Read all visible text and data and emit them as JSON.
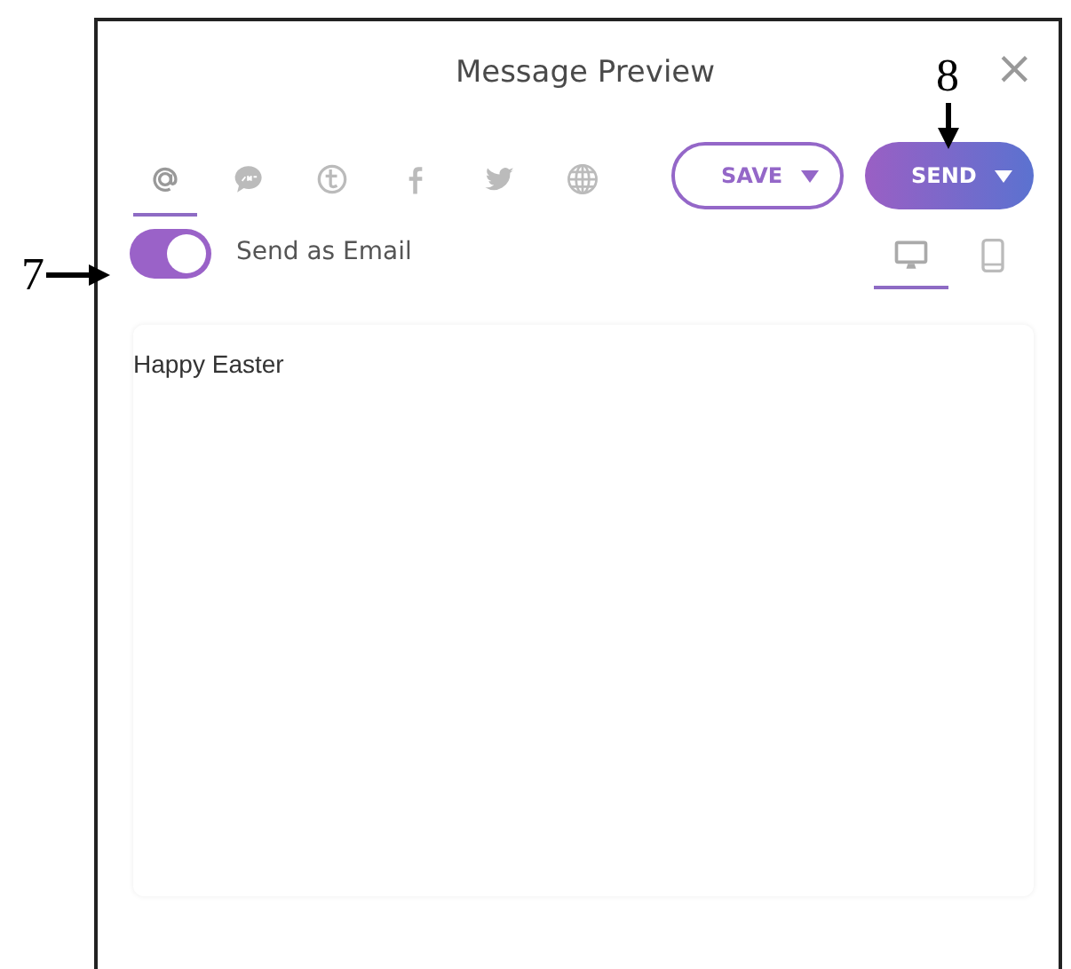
{
  "dialog": {
    "title": "Message Preview",
    "close": "×"
  },
  "channels": [
    {
      "kind": "email",
      "selected": true
    },
    {
      "kind": "sms",
      "selected": false
    },
    {
      "kind": "circle-t",
      "selected": false
    },
    {
      "kind": "facebook",
      "selected": false
    },
    {
      "kind": "twitter",
      "selected": false
    },
    {
      "kind": "web",
      "selected": false
    }
  ],
  "save_button": {
    "label": "SAVE"
  },
  "send_button": {
    "label": "SEND"
  },
  "send_as_email": {
    "label": "Send as Email",
    "on": true
  },
  "devices": [
    {
      "kind": "desktop",
      "selected": true
    },
    {
      "kind": "mobile",
      "selected": false
    }
  ],
  "message": {
    "text": "Happy Easter"
  },
  "callouts": [
    {
      "label": "7",
      "kind": "right-arrow"
    },
    {
      "label": "8",
      "kind": "down-arrow"
    }
  ]
}
